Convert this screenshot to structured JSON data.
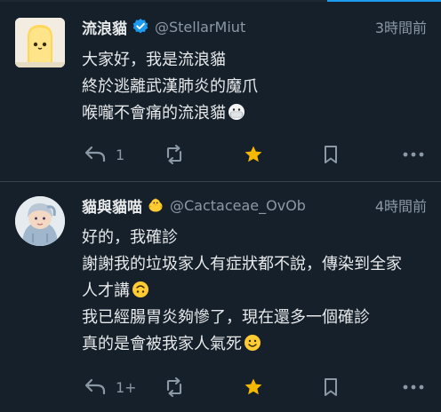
{
  "tweets": [
    {
      "name": "流浪貓",
      "handle": "@StellarMiut",
      "time": "3時間前",
      "verified": true,
      "lines": [
        "大家好，我是流浪貓",
        "終於逃離武漢肺炎的魔爪",
        "喉嚨不會痛的流浪貓"
      ],
      "line_emoji": [
        null,
        null,
        "mask-face-emoji"
      ],
      "reply_count": "1",
      "liked": true
    },
    {
      "name": "貓與貓喵",
      "handle": "@Cactaceae_OvOb",
      "time": "4時間前",
      "verified": false,
      "name_emoji": "chick-emoji",
      "lines": [
        "好的，我確診",
        "謝謝我的垃圾家人有症狀都不說，傳染到全家",
        "人才講",
        "我已經腸胃炎夠慘了，現在還多一個確診",
        "真的是會被我家人氣死"
      ],
      "line_emoji": [
        null,
        null,
        "upside-down-face-emoji",
        null,
        "smiling-face-emoji"
      ],
      "reply_count": "1+",
      "liked": true
    }
  ],
  "colors": {
    "background": "#15202b",
    "text": "#e7e9ea",
    "muted": "#8b98a5",
    "verified": "#1d9bf0",
    "like_active": "#f5b800",
    "divider": "#38444d"
  },
  "icons": [
    "reply-icon",
    "retweet-icon",
    "star-icon",
    "bookmark-icon",
    "more-icon",
    "verified-badge-icon"
  ]
}
